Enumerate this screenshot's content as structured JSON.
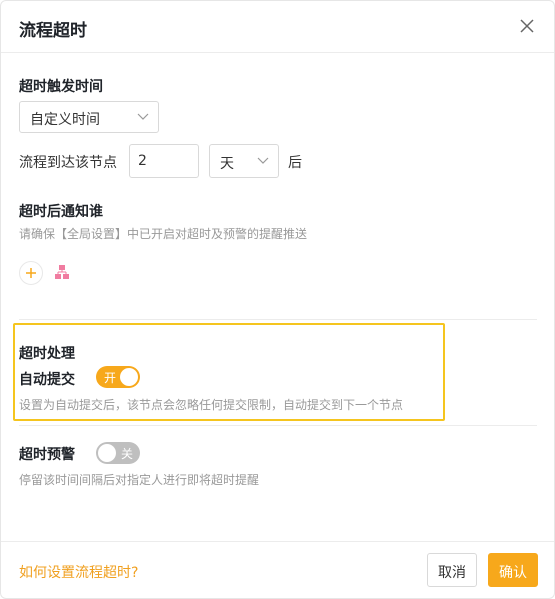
{
  "dialog": {
    "title": "流程超时"
  },
  "trigger": {
    "label": "超时触发时间",
    "type_select": "自定义时间",
    "arrive_label": "流程到达该节点",
    "amount": "2",
    "unit_select": "天",
    "after": "后"
  },
  "notify": {
    "label": "超时后通知谁",
    "hint": "请确保【全局设置】中已开启对超时及预警的提醒推送"
  },
  "handling": {
    "label": "超时处理",
    "auto_submit_label": "自动提交",
    "toggle_text": "开",
    "toggle_state": "on",
    "hint": "设置为自动提交后，该节点会忽略任何提交限制，自动提交到下一个节点"
  },
  "warning": {
    "label": "超时预警",
    "toggle_text": "关",
    "toggle_state": "off",
    "hint": "停留该时间间隔后对指定人进行即将超时提醒"
  },
  "footer": {
    "help_link": "如何设置流程超时?",
    "cancel": "取消",
    "confirm": "确认"
  },
  "colors": {
    "accent": "#f7a81b",
    "highlight_border": "#f5c51e",
    "org_icon": "#f07ca0"
  }
}
